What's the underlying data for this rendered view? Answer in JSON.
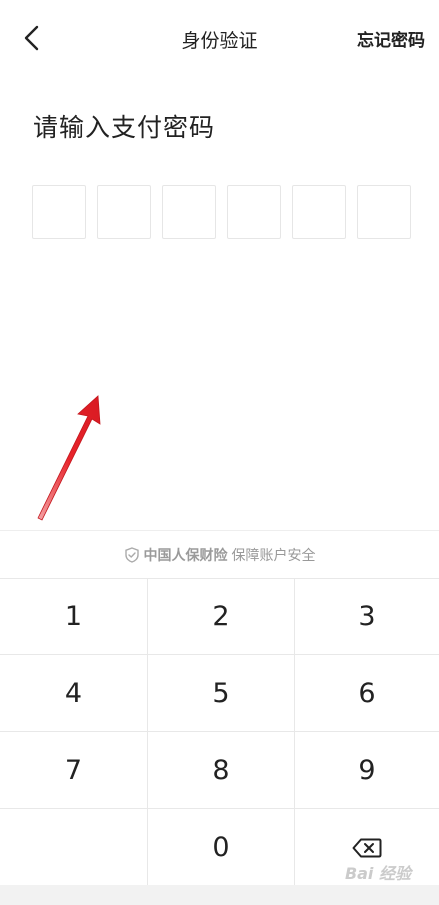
{
  "header": {
    "title": "身份验证",
    "forgot_label": "忘记密码",
    "back_icon": "chevron-left-icon"
  },
  "prompt": "请输入支付密码",
  "pin": {
    "length": 6,
    "filled": 0
  },
  "security": {
    "brand": "中国人保财险",
    "text": "保障账户安全"
  },
  "keypad": {
    "keys": [
      "1",
      "2",
      "3",
      "4",
      "5",
      "6",
      "7",
      "8",
      "9",
      "",
      "0",
      "backspace"
    ]
  },
  "watermark": "Bai 经验",
  "colors": {
    "annotation_arrow": "#e8242b",
    "text": "#222222",
    "muted": "#999999"
  }
}
